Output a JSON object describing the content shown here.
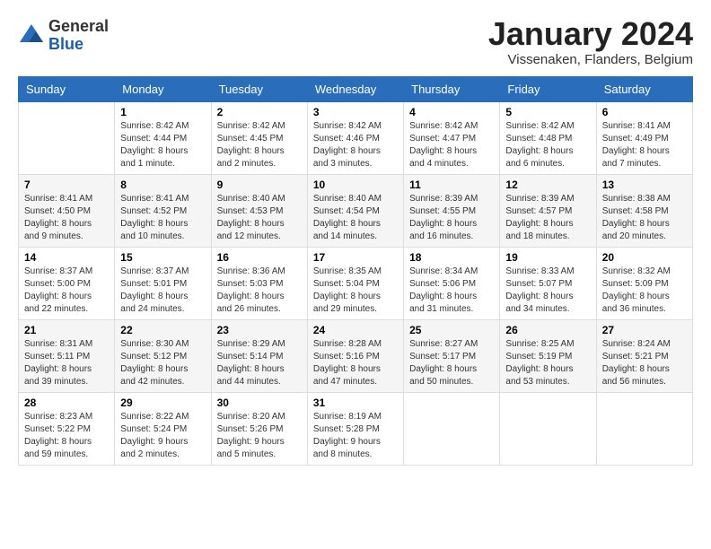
{
  "logo": {
    "general": "General",
    "blue": "Blue"
  },
  "title": "January 2024",
  "location": "Vissenaken, Flanders, Belgium",
  "days_of_week": [
    "Sunday",
    "Monday",
    "Tuesday",
    "Wednesday",
    "Thursday",
    "Friday",
    "Saturday"
  ],
  "weeks": [
    [
      {
        "day": "",
        "info": ""
      },
      {
        "day": "1",
        "info": "Sunrise: 8:42 AM\nSunset: 4:44 PM\nDaylight: 8 hours\nand 1 minute."
      },
      {
        "day": "2",
        "info": "Sunrise: 8:42 AM\nSunset: 4:45 PM\nDaylight: 8 hours\nand 2 minutes."
      },
      {
        "day": "3",
        "info": "Sunrise: 8:42 AM\nSunset: 4:46 PM\nDaylight: 8 hours\nand 3 minutes."
      },
      {
        "day": "4",
        "info": "Sunrise: 8:42 AM\nSunset: 4:47 PM\nDaylight: 8 hours\nand 4 minutes."
      },
      {
        "day": "5",
        "info": "Sunrise: 8:42 AM\nSunset: 4:48 PM\nDaylight: 8 hours\nand 6 minutes."
      },
      {
        "day": "6",
        "info": "Sunrise: 8:41 AM\nSunset: 4:49 PM\nDaylight: 8 hours\nand 7 minutes."
      }
    ],
    [
      {
        "day": "7",
        "info": "Sunrise: 8:41 AM\nSunset: 4:50 PM\nDaylight: 8 hours\nand 9 minutes."
      },
      {
        "day": "8",
        "info": "Sunrise: 8:41 AM\nSunset: 4:52 PM\nDaylight: 8 hours\nand 10 minutes."
      },
      {
        "day": "9",
        "info": "Sunrise: 8:40 AM\nSunset: 4:53 PM\nDaylight: 8 hours\nand 12 minutes."
      },
      {
        "day": "10",
        "info": "Sunrise: 8:40 AM\nSunset: 4:54 PM\nDaylight: 8 hours\nand 14 minutes."
      },
      {
        "day": "11",
        "info": "Sunrise: 8:39 AM\nSunset: 4:55 PM\nDaylight: 8 hours\nand 16 minutes."
      },
      {
        "day": "12",
        "info": "Sunrise: 8:39 AM\nSunset: 4:57 PM\nDaylight: 8 hours\nand 18 minutes."
      },
      {
        "day": "13",
        "info": "Sunrise: 8:38 AM\nSunset: 4:58 PM\nDaylight: 8 hours\nand 20 minutes."
      }
    ],
    [
      {
        "day": "14",
        "info": "Sunrise: 8:37 AM\nSunset: 5:00 PM\nDaylight: 8 hours\nand 22 minutes."
      },
      {
        "day": "15",
        "info": "Sunrise: 8:37 AM\nSunset: 5:01 PM\nDaylight: 8 hours\nand 24 minutes."
      },
      {
        "day": "16",
        "info": "Sunrise: 8:36 AM\nSunset: 5:03 PM\nDaylight: 8 hours\nand 26 minutes."
      },
      {
        "day": "17",
        "info": "Sunrise: 8:35 AM\nSunset: 5:04 PM\nDaylight: 8 hours\nand 29 minutes."
      },
      {
        "day": "18",
        "info": "Sunrise: 8:34 AM\nSunset: 5:06 PM\nDaylight: 8 hours\nand 31 minutes."
      },
      {
        "day": "19",
        "info": "Sunrise: 8:33 AM\nSunset: 5:07 PM\nDaylight: 8 hours\nand 34 minutes."
      },
      {
        "day": "20",
        "info": "Sunrise: 8:32 AM\nSunset: 5:09 PM\nDaylight: 8 hours\nand 36 minutes."
      }
    ],
    [
      {
        "day": "21",
        "info": "Sunrise: 8:31 AM\nSunset: 5:11 PM\nDaylight: 8 hours\nand 39 minutes."
      },
      {
        "day": "22",
        "info": "Sunrise: 8:30 AM\nSunset: 5:12 PM\nDaylight: 8 hours\nand 42 minutes."
      },
      {
        "day": "23",
        "info": "Sunrise: 8:29 AM\nSunset: 5:14 PM\nDaylight: 8 hours\nand 44 minutes."
      },
      {
        "day": "24",
        "info": "Sunrise: 8:28 AM\nSunset: 5:16 PM\nDaylight: 8 hours\nand 47 minutes."
      },
      {
        "day": "25",
        "info": "Sunrise: 8:27 AM\nSunset: 5:17 PM\nDaylight: 8 hours\nand 50 minutes."
      },
      {
        "day": "26",
        "info": "Sunrise: 8:25 AM\nSunset: 5:19 PM\nDaylight: 8 hours\nand 53 minutes."
      },
      {
        "day": "27",
        "info": "Sunrise: 8:24 AM\nSunset: 5:21 PM\nDaylight: 8 hours\nand 56 minutes."
      }
    ],
    [
      {
        "day": "28",
        "info": "Sunrise: 8:23 AM\nSunset: 5:22 PM\nDaylight: 8 hours\nand 59 minutes."
      },
      {
        "day": "29",
        "info": "Sunrise: 8:22 AM\nSunset: 5:24 PM\nDaylight: 9 hours\nand 2 minutes."
      },
      {
        "day": "30",
        "info": "Sunrise: 8:20 AM\nSunset: 5:26 PM\nDaylight: 9 hours\nand 5 minutes."
      },
      {
        "day": "31",
        "info": "Sunrise: 8:19 AM\nSunset: 5:28 PM\nDaylight: 9 hours\nand 8 minutes."
      },
      {
        "day": "",
        "info": ""
      },
      {
        "day": "",
        "info": ""
      },
      {
        "day": "",
        "info": ""
      }
    ]
  ]
}
